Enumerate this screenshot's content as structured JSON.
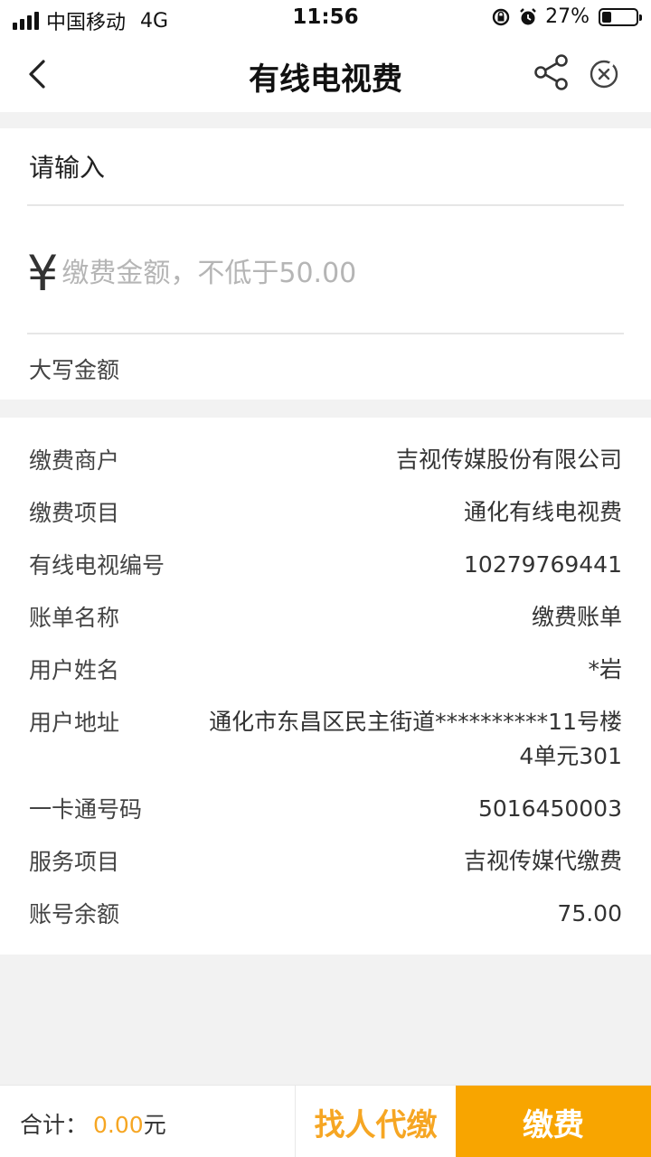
{
  "status_bar": {
    "carrier": "中国移动",
    "network": "4G",
    "time": "11:56",
    "battery": "27%",
    "battery_level": 0.27
  },
  "nav": {
    "title": "有线电视费"
  },
  "form": {
    "input_label": "请输入",
    "currency_symbol": "¥",
    "amount_placeholder": "缴费金额，不低于50.00",
    "amount_value": "",
    "upper_amount_label": "大写金额"
  },
  "details": [
    {
      "label": "缴费商户",
      "value": "吉视传媒股份有限公司"
    },
    {
      "label": "缴费项目",
      "value": "通化有线电视费"
    },
    {
      "label": "有线电视编号",
      "value": "10279769441"
    },
    {
      "label": "账单名称",
      "value": "缴费账单"
    },
    {
      "label": "用户姓名",
      "value": "*岩"
    },
    {
      "label": "用户地址",
      "value": "通化市东昌区民主街道**********11号楼4单元301"
    },
    {
      "label": "一卡通号码",
      "value": "5016450003"
    },
    {
      "label": "服务项目",
      "value": "吉视传媒代缴费"
    },
    {
      "label": "账号余额",
      "value": "75.00"
    }
  ],
  "footer": {
    "total_label": "合计：",
    "total_amount": "0.00",
    "total_unit": "元",
    "proxy_button": "找人代缴",
    "pay_button": "缴费"
  },
  "colors": {
    "accent": "#f8a500",
    "accent_text": "#f6a623"
  },
  "icons": [
    "signal-icon",
    "rotation-lock-icon",
    "alarm-icon",
    "battery-icon",
    "back-icon",
    "share-icon",
    "close-icon"
  ]
}
